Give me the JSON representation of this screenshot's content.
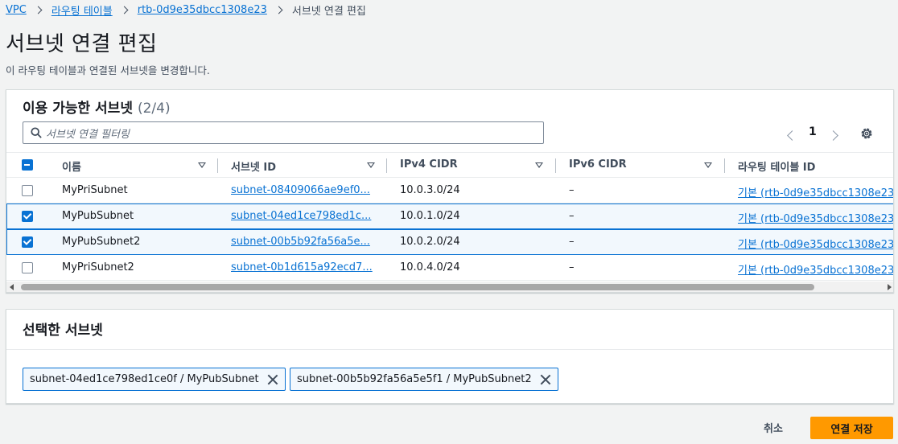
{
  "breadcrumb": {
    "items": [
      "VPC",
      "라우팅 테이블",
      "rtb-0d9e35dbcc1308e23"
    ],
    "current": "서브넷 연결 편집"
  },
  "page": {
    "title": "서브넷 연결 편집",
    "description": "이 라우팅 테이블과 연결된 서브넷을 변경합니다."
  },
  "available": {
    "header": "이용 가능한 서브넷",
    "count": "(2/4)",
    "filter_placeholder": "서브넷 연결 필터링",
    "page_number": "1",
    "columns": [
      "이름",
      "서브넷 ID",
      "IPv4 CIDR",
      "IPv6 CIDR",
      "라우팅 테이블 ID"
    ],
    "rows": [
      {
        "selected": false,
        "name": "MyPriSubnet",
        "subnet_id": "subnet-08409066ae9ef0...",
        "ipv4": "10.0.3.0/24",
        "ipv6": "–",
        "route_table": "기본 (rtb-0d9e35dbcc1308e23"
      },
      {
        "selected": true,
        "name": "MyPubSubnet",
        "subnet_id": "subnet-04ed1ce798ed1c...",
        "ipv4": "10.0.1.0/24",
        "ipv6": "–",
        "route_table": "기본 (rtb-0d9e35dbcc1308e23"
      },
      {
        "selected": true,
        "name": "MyPubSubnet2",
        "subnet_id": "subnet-00b5b92fa56a5e...",
        "ipv4": "10.0.2.0/24",
        "ipv6": "–",
        "route_table": "기본 (rtb-0d9e35dbcc1308e23"
      },
      {
        "selected": false,
        "name": "MyPriSubnet2",
        "subnet_id": "subnet-0b1d615a92ecd7...",
        "ipv4": "10.0.4.0/24",
        "ipv6": "–",
        "route_table": "기본 (rtb-0d9e35dbcc1308e23"
      }
    ]
  },
  "selected": {
    "header": "선택한 서브넷",
    "tokens": [
      "subnet-04ed1ce798ed1ce0f / MyPubSubnet",
      "subnet-00b5b92fa56a5e5f1 / MyPubSubnet2"
    ]
  },
  "actions": {
    "cancel": "취소",
    "save": "연결 저장"
  },
  "colors": {
    "link": "#0972d3",
    "primary_button": "#ff9900",
    "background": "#f2f3f3"
  }
}
